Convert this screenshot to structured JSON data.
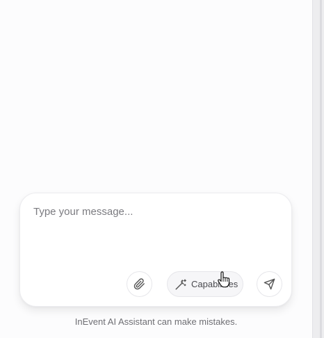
{
  "composer": {
    "placeholder": "Type your message...",
    "capabilities_label": "Capabilities",
    "attach_icon": "paperclip-icon",
    "capabilities_icon": "magic-wand-icon",
    "send_icon": "send-icon"
  },
  "disclaimer": "InEvent AI Assistant can make mistakes."
}
